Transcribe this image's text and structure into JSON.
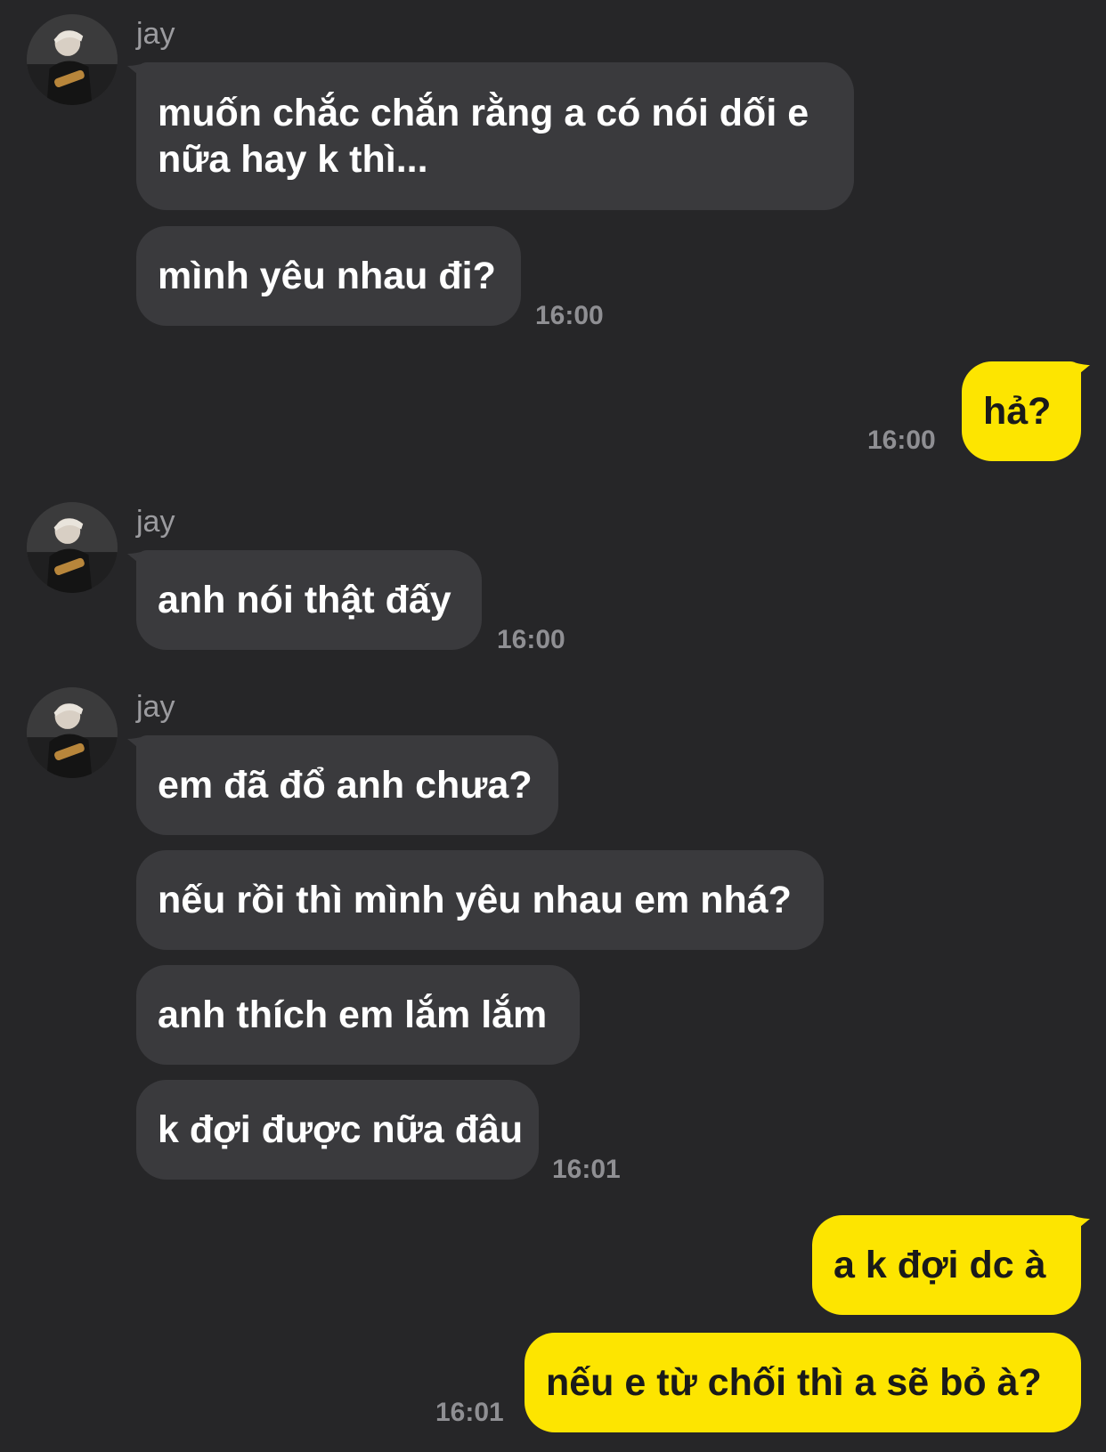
{
  "sender_name": "jay",
  "messages": {
    "m1_line1": "muốn chắc chắn rằng a có nói dối e",
    "m1_line2": "nữa hay k thì...",
    "m2": "mình yêu nhau đi?",
    "m3": "hả?",
    "m4": "anh nói thật đấy",
    "m5": "em đã đổ anh chưa?",
    "m6": "nếu rồi thì mình yêu nhau em nhá?",
    "m7": "anh thích em lắm lắm",
    "m8": "k đợi được nữa đâu",
    "m9": "a k đợi dc à",
    "m10": "nếu e từ chối thì a sẽ bỏ à?"
  },
  "times": {
    "t1": "16:00",
    "t2": "16:00",
    "t3": "16:00",
    "t4": "16:01",
    "t5": "16:01"
  },
  "colors": {
    "background": "#262628",
    "incoming_bubble": "#3a3a3d",
    "outgoing_bubble": "#fde500",
    "timestamp": "#8f8f93"
  }
}
